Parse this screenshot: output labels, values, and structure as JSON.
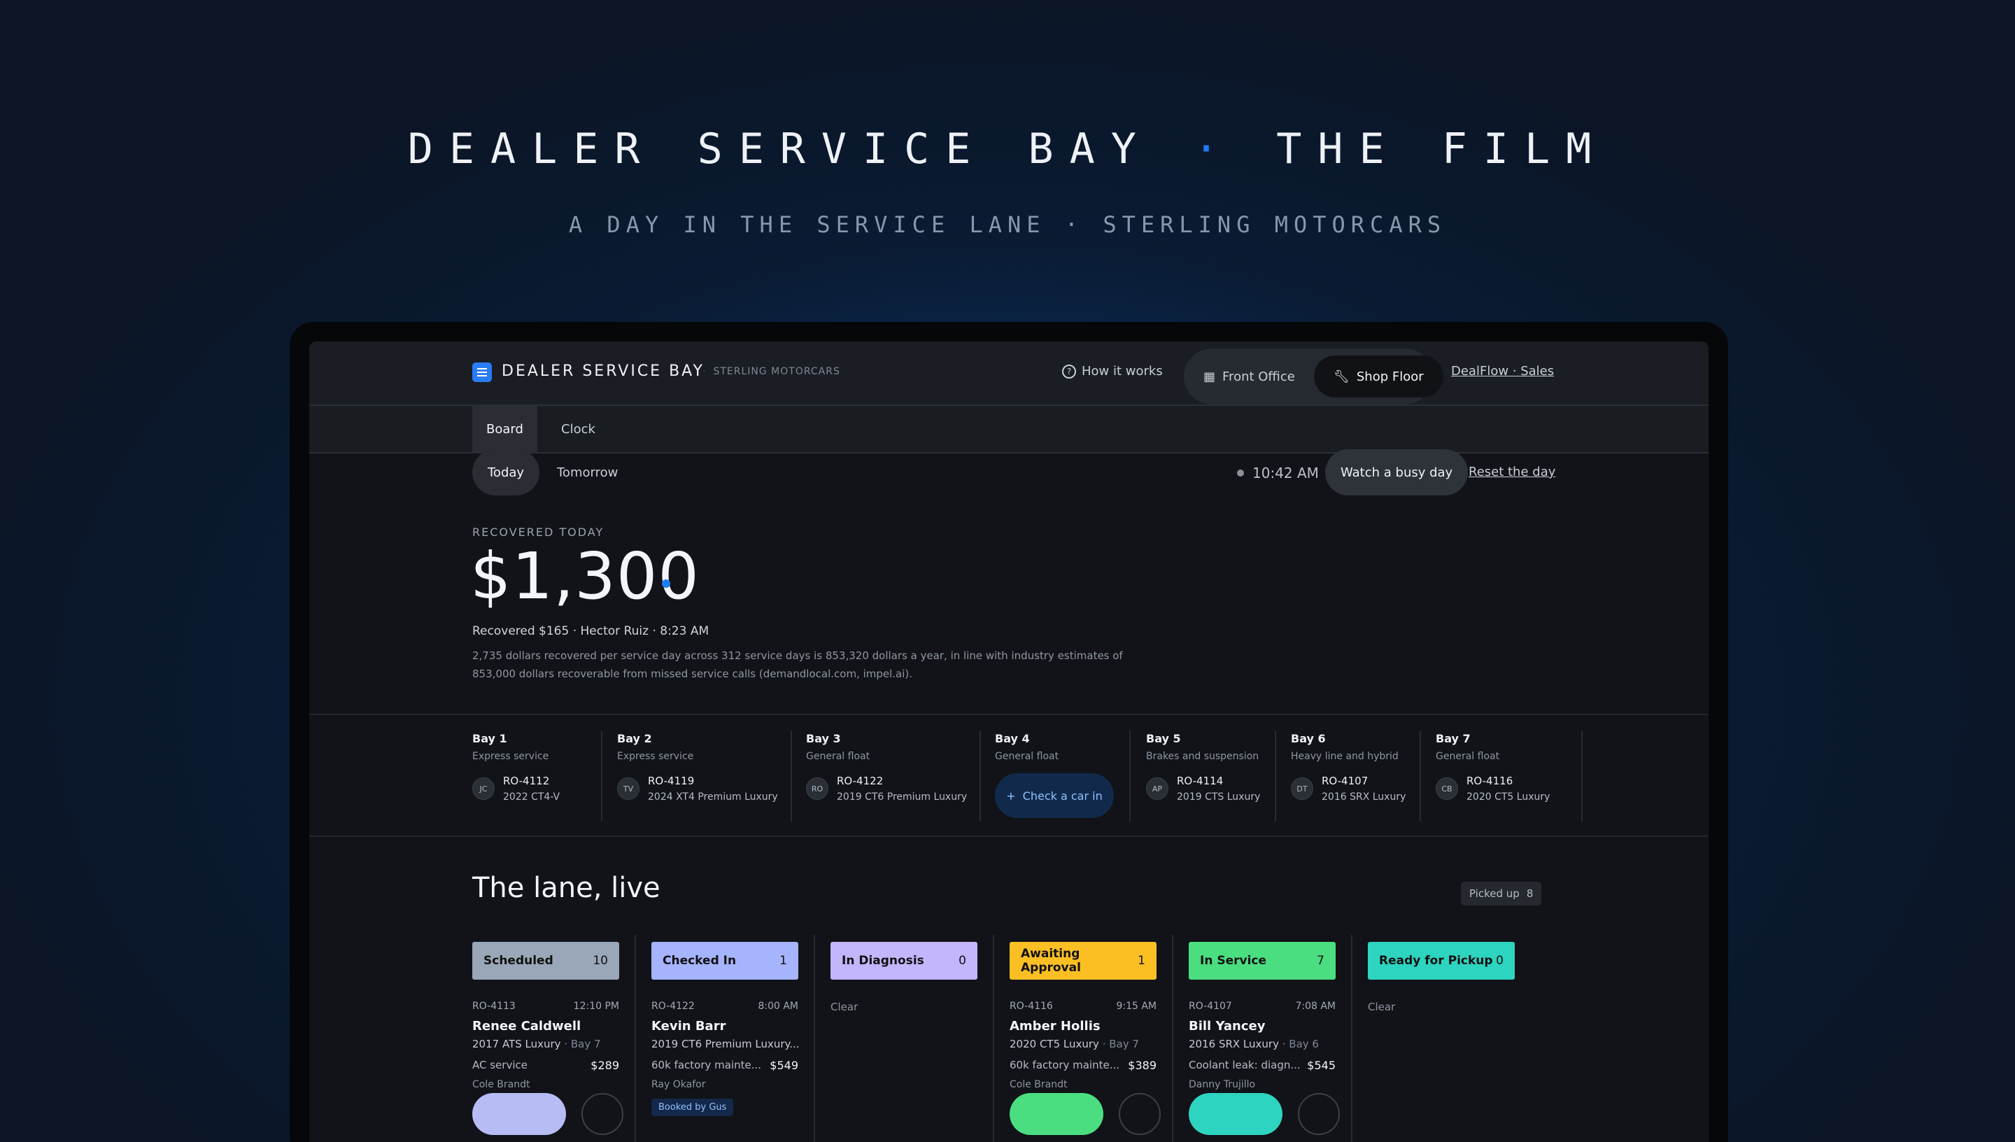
{
  "hero": {
    "title_left": "DEALER SERVICE BAY",
    "title_sep": "·",
    "title_right": "THE FILM",
    "subtitle": "A DAY IN THE SERVICE LANE · STERLING MOTORCARS"
  },
  "header": {
    "brand": "DEALER SERVICE BAY",
    "dealer": "STERLING MOTORCARS",
    "how_it_works": "How it works",
    "front_office": "Front Office",
    "shop_floor": "Shop Floor",
    "dealflow": "DealFlow · Sales"
  },
  "tabs": [
    "Board",
    "Clock"
  ],
  "days": [
    "Today",
    "Tomorrow"
  ],
  "clock": {
    "time": "10:42 AM",
    "watch": "Watch a busy day",
    "reset": "Reset the day"
  },
  "recovered": {
    "label": "RECOVERED TODAY",
    "amount": "$1,300",
    "last": "Recovered $165 · Hector Ruiz · 8:23 AM",
    "desc": "2,735 dollars recovered per service day across 312 service days is 853,320 dollars a year, in line with industry estimates of 853,000 dollars recoverable from missed service calls (demandlocal.com, impel.ai)."
  },
  "bays": [
    {
      "name": "Bay 1",
      "type": "Express service",
      "initials": "JC",
      "ro": "RO-4112",
      "car": "2022 CT4-V"
    },
    {
      "name": "Bay 2",
      "type": "Express service",
      "initials": "TV",
      "ro": "RO-4119",
      "car": "2024 XT4 Premium Luxury"
    },
    {
      "name": "Bay 3",
      "type": "General float",
      "initials": "RO",
      "ro": "RO-4122",
      "car": "2019 CT6 Premium Luxury"
    },
    {
      "name": "Bay 4",
      "type": "General float",
      "checkin": "Check a car in"
    },
    {
      "name": "Bay 5",
      "type": "Brakes and suspension",
      "initials": "AP",
      "ro": "RO-4114",
      "car": "2019 CTS Luxury"
    },
    {
      "name": "Bay 6",
      "type": "Heavy line and hybrid",
      "initials": "DT",
      "ro": "RO-4107",
      "car": "2016 SRX Luxury"
    },
    {
      "name": "Bay 7",
      "type": "General float",
      "initials": "CB",
      "ro": "RO-4116",
      "car": "2020 CT5 Luxury"
    }
  ],
  "lane": {
    "title": "The lane, live",
    "picked_label": "Picked up",
    "picked_count": "8"
  },
  "columns": [
    {
      "label": "Scheduled",
      "count": "10",
      "color": "#9aa7b8",
      "card": {
        "ro": "RO-4113",
        "time": "12:10 PM",
        "customer": "Renee Caldwell",
        "vehicle": "2017 ATS Luxury",
        "bay": "· Bay 7",
        "service": "AC service",
        "price": "$289",
        "tech": "Cole Brandt"
      },
      "btn": "#b7bcf4"
    },
    {
      "label": "Checked In",
      "count": "1",
      "color": "#a5b4fc",
      "card": {
        "ro": "RO-4122",
        "time": "8:00 AM",
        "customer": "Kevin Barr",
        "vehicle": "2019 CT6 Premium Luxury...",
        "bay": "",
        "service": "60k factory mainte...",
        "price": "$549",
        "tech": "Ray Okafor",
        "badge": "Booked by Gus"
      }
    },
    {
      "label": "In Diagnosis",
      "count": "0",
      "color": "#c4b5fd",
      "clear": "Clear"
    },
    {
      "label": "Awaiting Approval",
      "count": "1",
      "color": "#fbbf24",
      "card": {
        "ro": "RO-4116",
        "time": "9:15 AM",
        "customer": "Amber Hollis",
        "vehicle": "2020 CT5 Luxury",
        "bay": "· Bay 7",
        "service": "60k factory mainte...",
        "price": "$389",
        "tech": "Cole Brandt"
      },
      "btn": "#4ade80"
    },
    {
      "label": "In Service",
      "count": "7",
      "color": "#4ade80",
      "card": {
        "ro": "RO-4107",
        "time": "7:08 AM",
        "customer": "Bill Yancey",
        "vehicle": "2016 SRX Luxury",
        "bay": "· Bay 6",
        "service": "Coolant leak: diagn...",
        "price": "$545",
        "tech": "Danny Trujillo"
      },
      "btn": "#2dd4bf"
    },
    {
      "label": "Ready for Pickup",
      "count": "0",
      "color": "#2dd4bf",
      "clear": "Clear"
    }
  ]
}
